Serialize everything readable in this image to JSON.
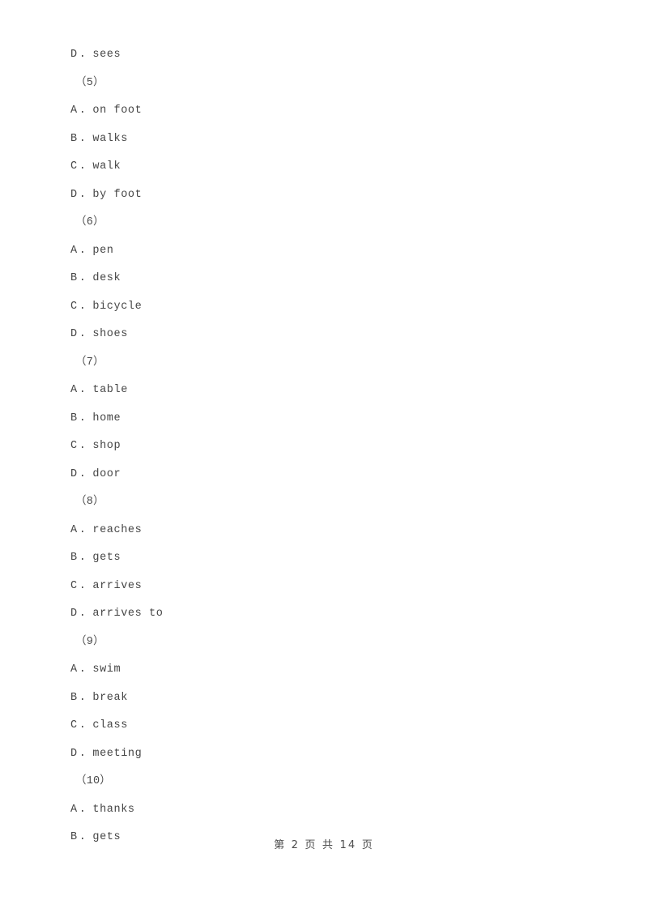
{
  "document": {
    "page_background": "#ffffff",
    "text_color": "#454545",
    "body": [
      {
        "kind": "option",
        "letter": "D",
        "separator": ".",
        "text": "sees"
      },
      {
        "kind": "qnum",
        "text": "（5）"
      },
      {
        "kind": "option",
        "letter": "A",
        "separator": ".",
        "text": "on foot"
      },
      {
        "kind": "option",
        "letter": "B",
        "separator": ".",
        "text": "walks"
      },
      {
        "kind": "option",
        "letter": "C",
        "separator": ".",
        "text": "walk"
      },
      {
        "kind": "option",
        "letter": "D",
        "separator": ".",
        "text": "by foot"
      },
      {
        "kind": "qnum",
        "text": "（6）"
      },
      {
        "kind": "option",
        "letter": "A",
        "separator": ".",
        "text": "pen"
      },
      {
        "kind": "option",
        "letter": "B",
        "separator": ".",
        "text": "desk"
      },
      {
        "kind": "option",
        "letter": "C",
        "separator": ".",
        "text": "bicycle"
      },
      {
        "kind": "option",
        "letter": "D",
        "separator": ".",
        "text": "shoes"
      },
      {
        "kind": "qnum",
        "text": "（7）"
      },
      {
        "kind": "option",
        "letter": "A",
        "separator": ".",
        "text": "table"
      },
      {
        "kind": "option",
        "letter": "B",
        "separator": ".",
        "text": "home"
      },
      {
        "kind": "option",
        "letter": "C",
        "separator": ".",
        "text": "shop"
      },
      {
        "kind": "option",
        "letter": "D",
        "separator": ".",
        "text": "door"
      },
      {
        "kind": "qnum",
        "text": "（8）"
      },
      {
        "kind": "option",
        "letter": "A",
        "separator": ".",
        "text": "reaches"
      },
      {
        "kind": "option",
        "letter": "B",
        "separator": ".",
        "text": "gets"
      },
      {
        "kind": "option",
        "letter": "C",
        "separator": ".",
        "text": "arrives"
      },
      {
        "kind": "option",
        "letter": "D",
        "separator": ".",
        "text": "arrives to"
      },
      {
        "kind": "qnum",
        "text": "（9）"
      },
      {
        "kind": "option",
        "letter": "A",
        "separator": ".",
        "text": "swim"
      },
      {
        "kind": "option",
        "letter": "B",
        "separator": ".",
        "text": "break"
      },
      {
        "kind": "option",
        "letter": "C",
        "separator": ".",
        "text": "class"
      },
      {
        "kind": "option",
        "letter": "D",
        "separator": ".",
        "text": "meeting"
      },
      {
        "kind": "qnum",
        "text": "（10）"
      },
      {
        "kind": "option",
        "letter": "A",
        "separator": ".",
        "text": "thanks"
      },
      {
        "kind": "option",
        "letter": "B",
        "separator": ".",
        "text": "gets"
      }
    ]
  },
  "footer": {
    "page_label": "第 2 页 共 14 页",
    "current_page": "2",
    "total_pages": "14"
  }
}
